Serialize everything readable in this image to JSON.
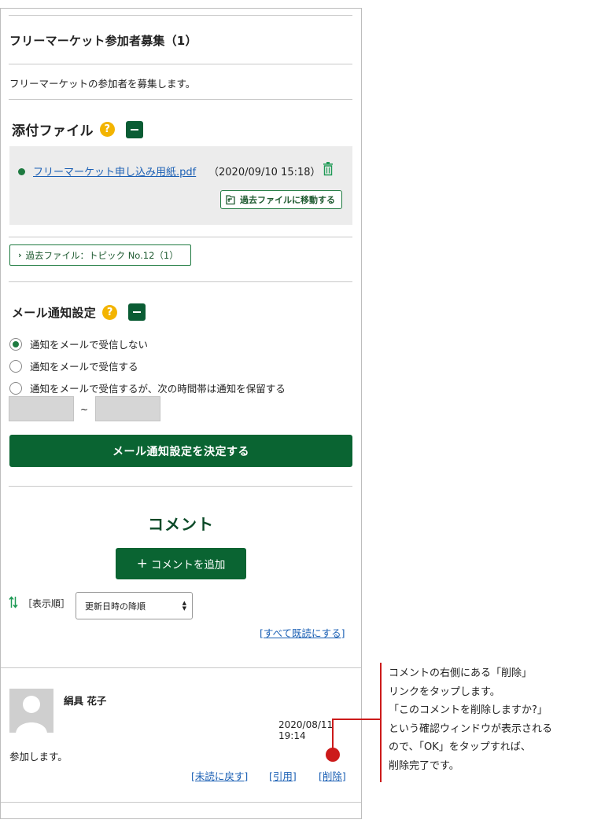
{
  "topic": {
    "title": "フリーマーケット参加者募集（1）",
    "description": "フリーマーケットの参加者を募集します。"
  },
  "attachments": {
    "heading": "添付ファイル",
    "help": "?",
    "file": {
      "name": "フリーマーケット申し込み用紙.pdf",
      "date": "（2020/09/10 15:18）"
    },
    "move_button": "過去ファイルに移動する",
    "past_button": "過去ファイル：トピック No.12（1）",
    "past_chevron": "›"
  },
  "notify": {
    "heading": "メール通知設定",
    "help": "?",
    "options": [
      {
        "label": "通知をメールで受信しない",
        "selected": true
      },
      {
        "label": "通知をメールで受信する",
        "selected": false
      },
      {
        "label": "通知をメールで受信するが、次の時間帯は通知を保留する",
        "selected": false
      }
    ],
    "time_from": "",
    "time_to": "",
    "tilde": "~",
    "submit": "メール通知設定を決定する"
  },
  "comments": {
    "title": "コメント",
    "add_plus": "+",
    "add_button": "コメントを追加",
    "sort_label": "［表示順］",
    "sort_value": "更新日時の降順",
    "mark_all_read": "[すべて既読にする]",
    "item": {
      "author": "絹具 花子",
      "date": "2020/08/11 19:14",
      "body": "参加します。",
      "actions": {
        "unread": "[未読に戻す]",
        "quote": "[引用]",
        "delete": "[削除]"
      }
    }
  },
  "callout": {
    "lines": [
      "コメントの右側にある「削除」",
      "リンクをタップします。",
      "「このコメントを削除しますか?」",
      "という確認ウィンドウが表示される",
      "ので、「OK」をタップすれば、",
      "削除完了です。"
    ],
    "color": "#cc1a1a"
  },
  "colors": {
    "brand_green": "#0a6432",
    "link_blue": "#1a5fb4",
    "help_yellow": "#f3b400"
  }
}
